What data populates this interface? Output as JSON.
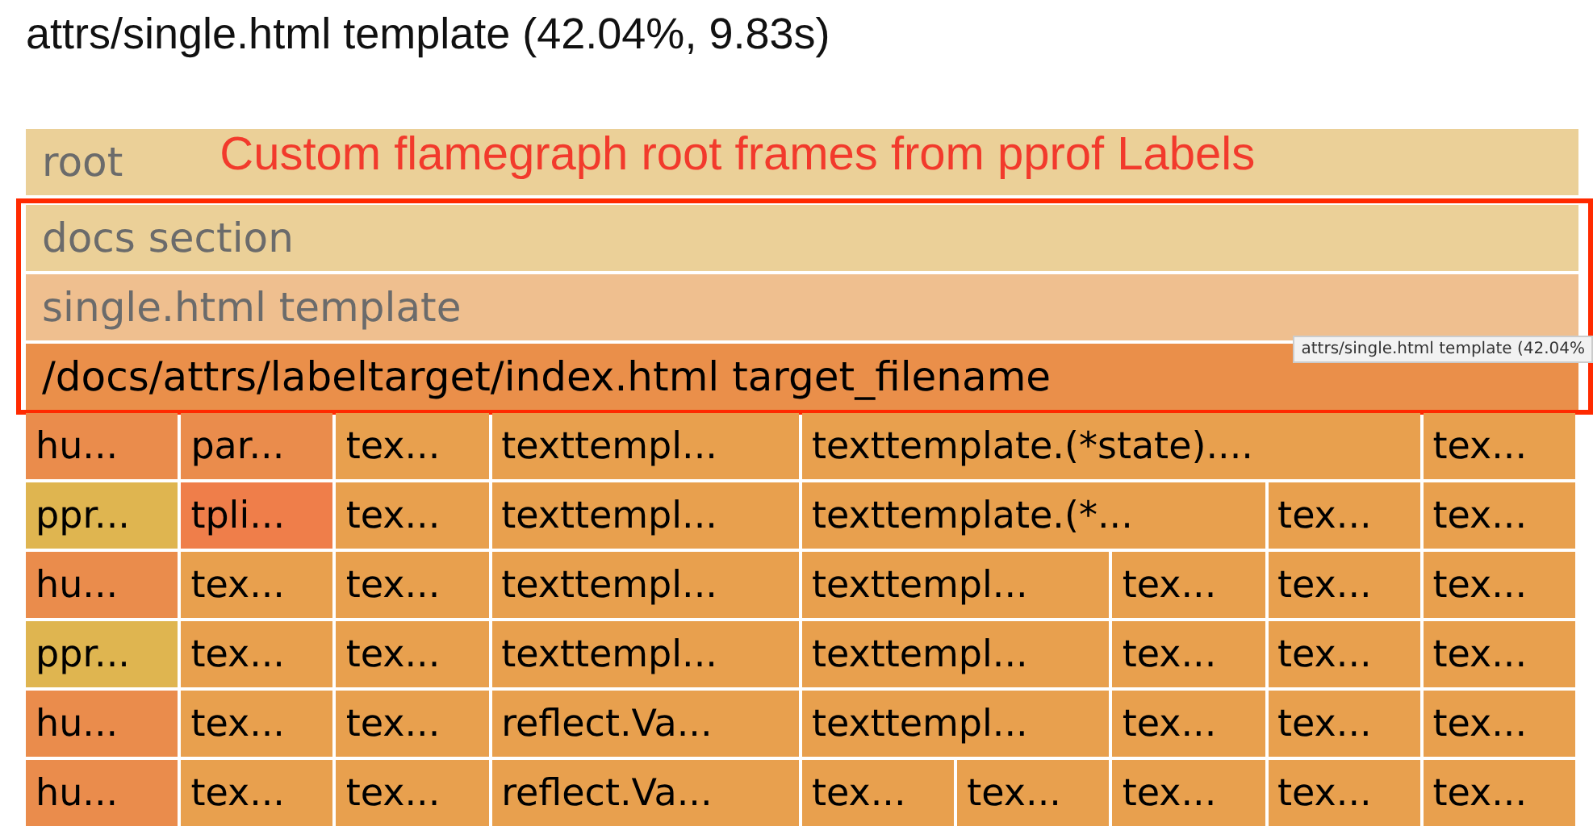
{
  "title": "attrs/single.html template (42.04%, 9.83s)",
  "annotation": "Custom flamegraph root frames from pprof Labels",
  "tooltip": "attrs/single.html template (42.04%",
  "root_frames": [
    {
      "label": "root",
      "color": "#ebd098",
      "dimmed": true,
      "highlighted": false
    },
    {
      "label": "docs section",
      "color": "#ebd098",
      "dimmed": true,
      "highlighted": true
    },
    {
      "label": "single.html template",
      "color": "#efbf8f",
      "dimmed": true,
      "highlighted": true
    },
    {
      "label": "/docs/attrs/labeltarget/index.html target_filename",
      "color": "#ea8f4a",
      "dimmed": false,
      "highlighted": true
    }
  ],
  "rows": [
    [
      {
        "label": "hu...",
        "color": "#ea8c4c"
      },
      {
        "label": "par...",
        "color": "#ea8c4c"
      },
      {
        "label": "tex...",
        "color": "#e8a04e"
      },
      {
        "label": "texttempl...",
        "color": "#e8a04e"
      },
      {
        "label": "texttemplate.(*state)....",
        "color": "#e8a04e"
      },
      {
        "label": "tex...",
        "color": "#e8a04e"
      }
    ],
    [
      {
        "label": "ppr...",
        "color": "#dfb550"
      },
      {
        "label": "tpli...",
        "color": "#ef7e4a"
      },
      {
        "label": "tex...",
        "color": "#e8a04e"
      },
      {
        "label": "texttempl...",
        "color": "#e8a04e"
      },
      {
        "label": "texttemplate.(*...",
        "color": "#e8a04e"
      },
      {
        "label": "tex...",
        "color": "#e8a04e"
      },
      {
        "label": "tex...",
        "color": "#e8a04e"
      }
    ],
    [
      {
        "label": "hu...",
        "color": "#ea8c4c"
      },
      {
        "label": "tex...",
        "color": "#e8a04e"
      },
      {
        "label": "tex...",
        "color": "#e8a04e"
      },
      {
        "label": "texttempl...",
        "color": "#e8a04e"
      },
      {
        "label": "texttempl...",
        "color": "#e8a04e"
      },
      {
        "label": "tex...",
        "color": "#e8a04e"
      },
      {
        "label": "tex...",
        "color": "#e8a04e"
      },
      {
        "label": "tex...",
        "color": "#e8a04e"
      }
    ],
    [
      {
        "label": "ppr...",
        "color": "#dfb550"
      },
      {
        "label": "tex...",
        "color": "#e8a04e"
      },
      {
        "label": "tex...",
        "color": "#e8a04e"
      },
      {
        "label": "texttempl...",
        "color": "#e8a04e"
      },
      {
        "label": "texttempl...",
        "color": "#e8a04e"
      },
      {
        "label": "tex...",
        "color": "#e8a04e"
      },
      {
        "label": "tex...",
        "color": "#e8a04e"
      },
      {
        "label": "tex...",
        "color": "#e8a04e"
      }
    ],
    [
      {
        "label": "hu...",
        "color": "#ea8c4c"
      },
      {
        "label": "tex...",
        "color": "#e8a04e"
      },
      {
        "label": "tex...",
        "color": "#e8a04e"
      },
      {
        "label": "reflect.Va...",
        "color": "#e8a04e"
      },
      {
        "label": "texttempl...",
        "color": "#e8a04e"
      },
      {
        "label": "tex...",
        "color": "#e8a04e"
      },
      {
        "label": "tex...",
        "color": "#e8a04e"
      },
      {
        "label": "tex...",
        "color": "#e8a04e"
      }
    ],
    [
      {
        "label": "hu...",
        "color": "#ea8c4c"
      },
      {
        "label": "tex...",
        "color": "#e8a04e"
      },
      {
        "label": "tex...",
        "color": "#e8a04e"
      },
      {
        "label": "reflect.Va...",
        "color": "#e8a04e"
      },
      {
        "label": "tex...",
        "color": "#e8a04e"
      },
      {
        "label": "tex...",
        "color": "#e8a04e"
      },
      {
        "label": "tex...",
        "color": "#e8a04e"
      },
      {
        "label": "tex...",
        "color": "#e8a04e"
      },
      {
        "label": "tex...",
        "color": "#e8a04e"
      }
    ]
  ]
}
